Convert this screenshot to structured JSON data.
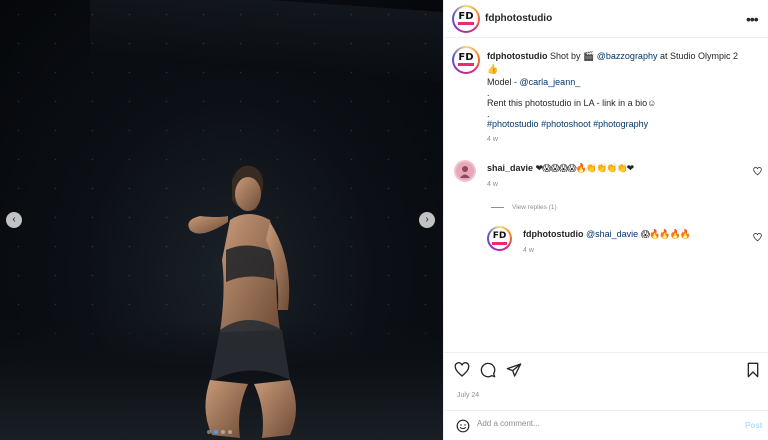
{
  "account": {
    "username": "fdphotostudio",
    "logo_text": "FD"
  },
  "caption": {
    "username": "fdphotostudio",
    "line1_prefix": "Shot by",
    "line1_camera": "🎬",
    "line1_mention": "@bazzography",
    "line1_suffix": "at Studio Olympic 2",
    "line1_emoji": "👍",
    "model_label": "Model -",
    "model_mention": "@carla_jeann_",
    "dot1": ".",
    "rent_text": "Rent this photostudio in LA - link in a bio☺",
    "dot2": ".",
    "hashtags": [
      "#photostudio",
      "#photoshoot",
      "#photography"
    ],
    "time": "4 w"
  },
  "comments": [
    {
      "username": "shai_davie",
      "text": "❤😱😱😱😱🔥👏👏👏👏❤",
      "time": "4 w"
    },
    {
      "username": "fdphotostudio",
      "mention": "@shai_davie",
      "text": "😱🔥🔥🔥🔥",
      "time": "4 w"
    }
  ],
  "view_replies": "View replies (1)",
  "post_date": "July 24",
  "add_comment": {
    "placeholder": "Add a comment...",
    "post_label": "Post"
  },
  "icons": {
    "prev": "chevron-left-icon",
    "next": "chevron-right-icon",
    "like": "heart-icon",
    "comment": "comment-icon",
    "share": "paper-plane-icon",
    "save": "bookmark-icon",
    "emoji": "smile-icon",
    "more": "more-icon"
  },
  "carousel": {
    "slides": 4,
    "active_index": 1
  },
  "colors": {
    "link": "#00376b",
    "muted": "#8e8e8e",
    "active_dot": "#4b9dff"
  }
}
